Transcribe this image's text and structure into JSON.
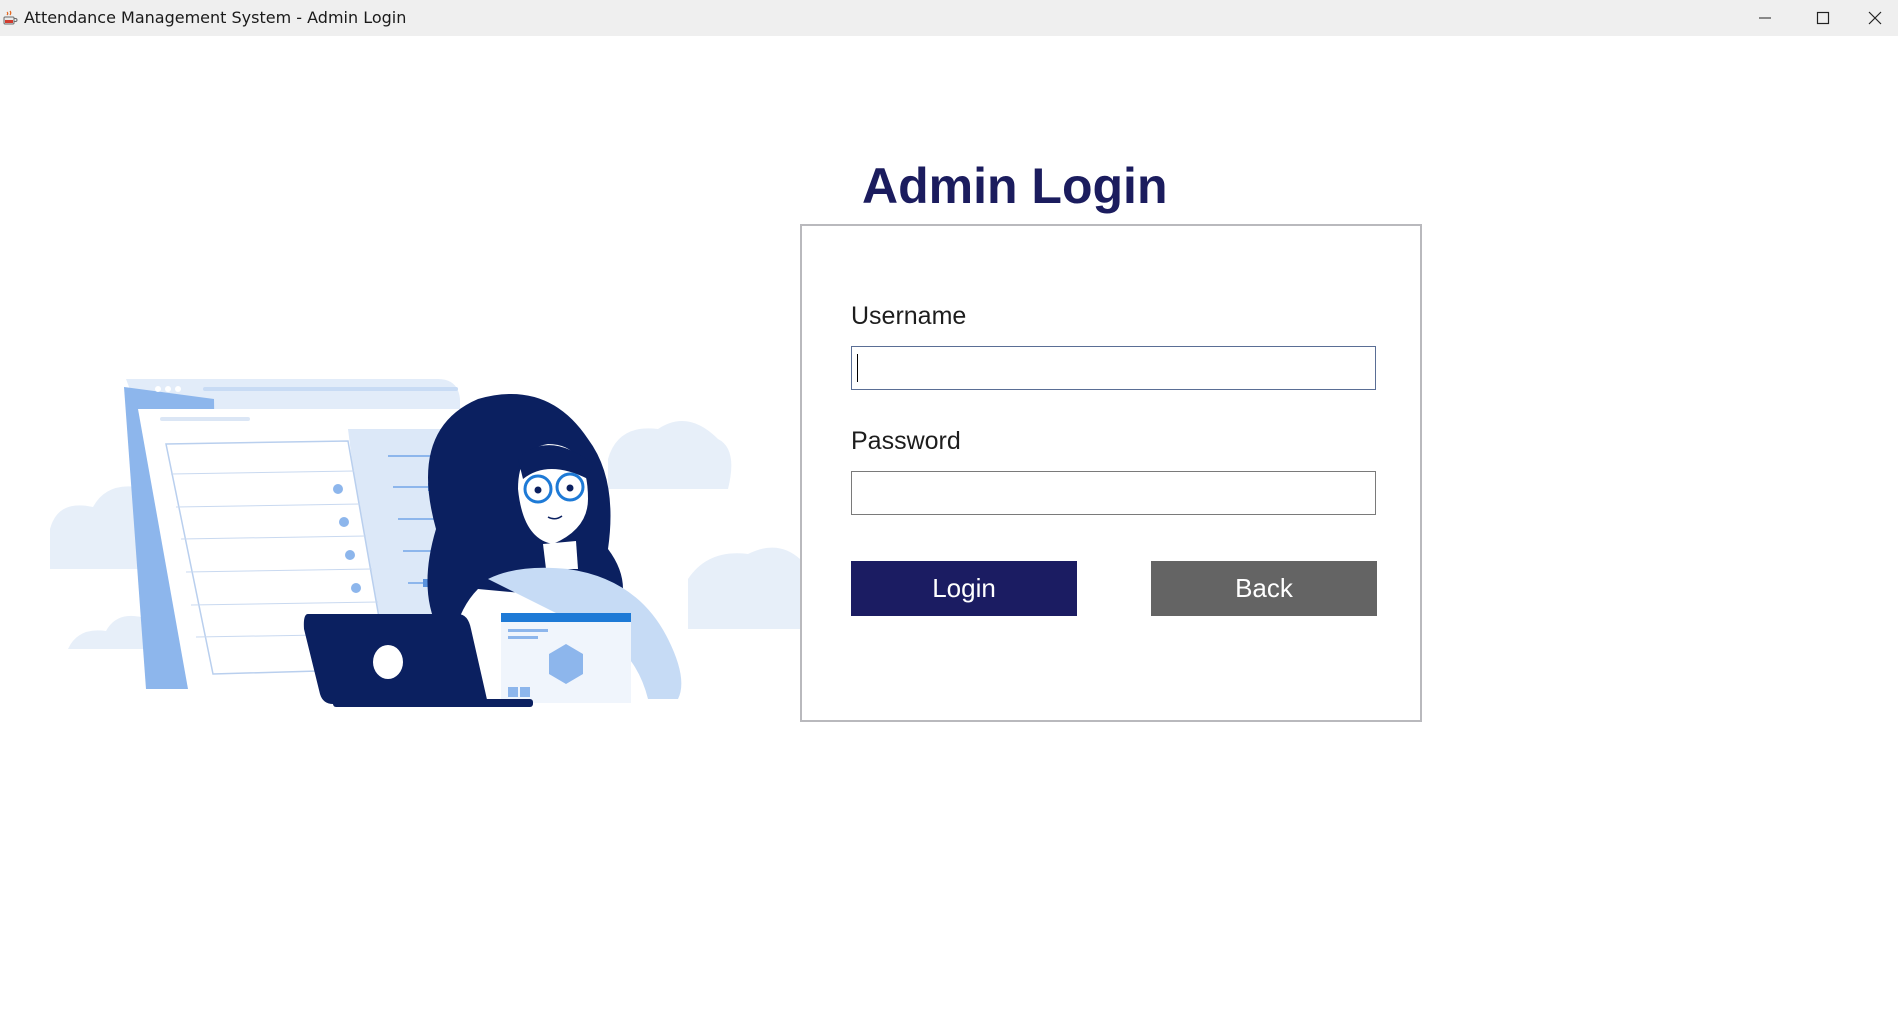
{
  "window": {
    "title": "Attendance Management System - Admin Login",
    "icon": "java-coffee-icon",
    "controls": [
      "minimize-icon",
      "maximize-icon",
      "close-icon"
    ]
  },
  "page": {
    "title": "Admin Login"
  },
  "form": {
    "username_label": "Username",
    "username_value": "",
    "password_label": "Password",
    "password_value": "",
    "login_label": "Login",
    "back_label": "Back"
  },
  "colors": {
    "title_text": "#1b1c5e",
    "login_button": "#1b1c62",
    "back_button": "#646464",
    "panel_border": "#b9b9bd",
    "illustration_navy": "#0b2060",
    "illustration_light_blue": "#dbe8f8",
    "illustration_accent": "#1e7ad6"
  }
}
